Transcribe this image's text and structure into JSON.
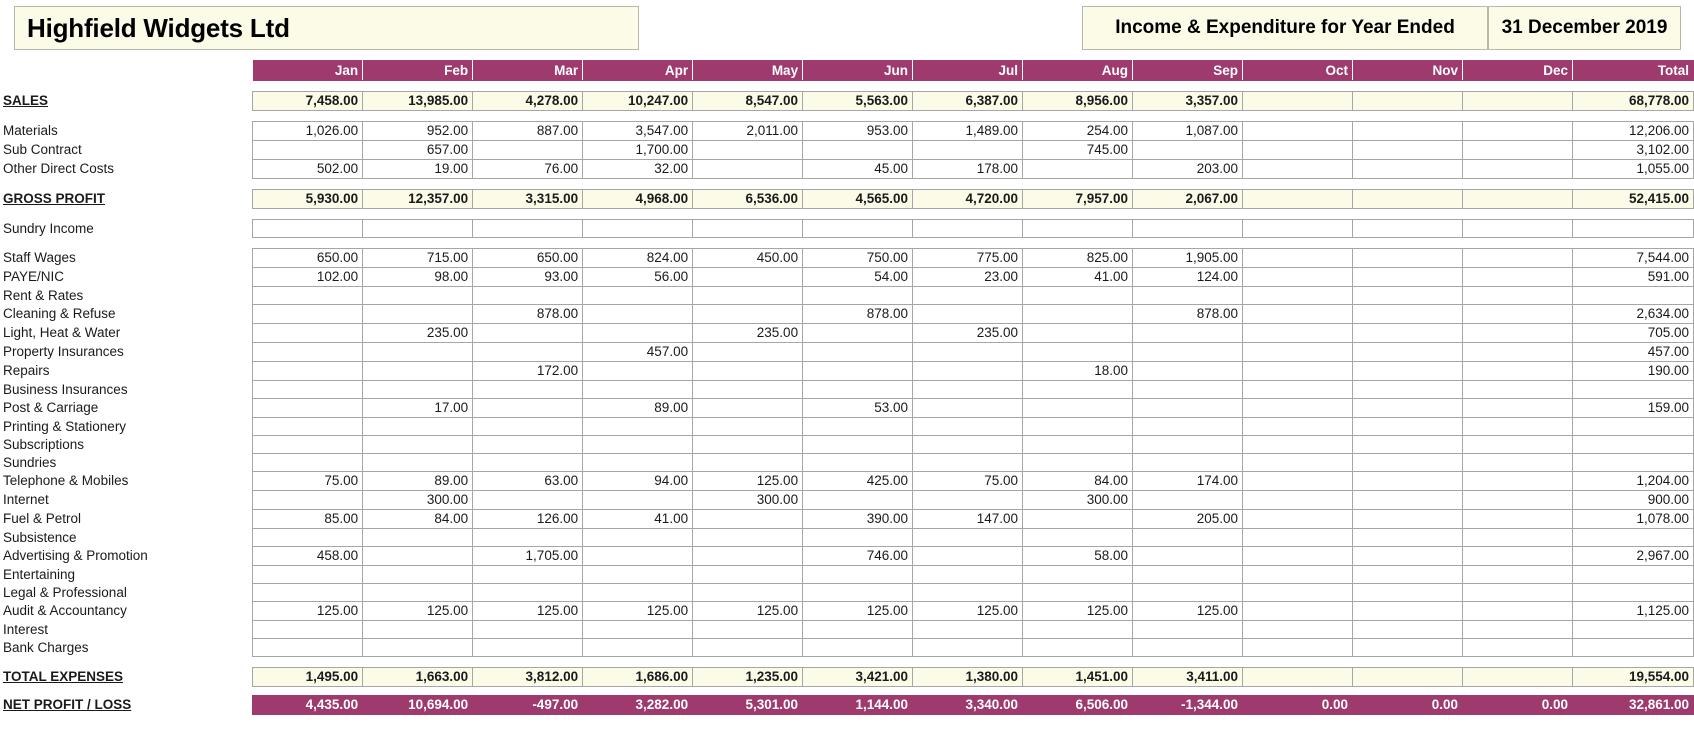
{
  "header": {
    "company": "Highfield Widgets Ltd",
    "doc_title": "Income & Expenditure for Year Ended",
    "doc_date": "31 December 2019"
  },
  "colors": {
    "accent": "#9e3a6d",
    "cream": "#fbfbe8",
    "grid": "#a6a6a6"
  },
  "columns": [
    "Jan",
    "Feb",
    "Mar",
    "Apr",
    "May",
    "Jun",
    "Jul",
    "Aug",
    "Sep",
    "Oct",
    "Nov",
    "Dec",
    "Total"
  ],
  "rows": [
    {
      "type": "gap"
    },
    {
      "type": "accent",
      "label": "SALES",
      "head": true,
      "values": [
        "7,458.00",
        "13,985.00",
        "4,278.00",
        "10,247.00",
        "8,547.00",
        "5,563.00",
        "6,387.00",
        "8,956.00",
        "3,357.00",
        "",
        "",
        "",
        "68,778.00"
      ]
    },
    {
      "type": "gap"
    },
    {
      "type": "data",
      "label": "Materials",
      "values": [
        "1,026.00",
        "952.00",
        "887.00",
        "3,547.00",
        "2,011.00",
        "953.00",
        "1,489.00",
        "254.00",
        "1,087.00",
        "",
        "",
        "",
        "12,206.00"
      ]
    },
    {
      "type": "data",
      "label": "Sub Contract",
      "values": [
        "",
        "657.00",
        "",
        "1,700.00",
        "",
        "",
        "",
        "745.00",
        "",
        "",
        "",
        "",
        "3,102.00"
      ]
    },
    {
      "type": "data",
      "label": "Other Direct Costs",
      "values": [
        "502.00",
        "19.00",
        "76.00",
        "32.00",
        "",
        "45.00",
        "178.00",
        "",
        "203.00",
        "",
        "",
        "",
        "1,055.00"
      ]
    },
    {
      "type": "gap"
    },
    {
      "type": "accent",
      "label": "GROSS PROFIT",
      "head": true,
      "values": [
        "5,930.00",
        "12,357.00",
        "3,315.00",
        "4,968.00",
        "6,536.00",
        "4,565.00",
        "4,720.00",
        "7,957.00",
        "2,067.00",
        "",
        "",
        "",
        "52,415.00"
      ]
    },
    {
      "type": "gap"
    },
    {
      "type": "data",
      "label": "Sundry Income",
      "values": [
        "",
        "",
        "",
        "",
        "",
        "",
        "",
        "",
        "",
        "",
        "",
        "",
        ""
      ]
    },
    {
      "type": "gap"
    },
    {
      "type": "data",
      "label": "Staff Wages",
      "values": [
        "650.00",
        "715.00",
        "650.00",
        "824.00",
        "450.00",
        "750.00",
        "775.00",
        "825.00",
        "1,905.00",
        "",
        "",
        "",
        "7,544.00"
      ]
    },
    {
      "type": "data",
      "label": "PAYE/NIC",
      "values": [
        "102.00",
        "98.00",
        "93.00",
        "56.00",
        "",
        "54.00",
        "23.00",
        "41.00",
        "124.00",
        "",
        "",
        "",
        "591.00"
      ]
    },
    {
      "type": "data",
      "label": "Rent & Rates",
      "values": [
        "",
        "",
        "",
        "",
        "",
        "",
        "",
        "",
        "",
        "",
        "",
        "",
        ""
      ]
    },
    {
      "type": "data",
      "label": "Cleaning & Refuse",
      "values": [
        "",
        "",
        "878.00",
        "",
        "",
        "878.00",
        "",
        "",
        "878.00",
        "",
        "",
        "",
        "2,634.00"
      ]
    },
    {
      "type": "data",
      "label": "Light, Heat & Water",
      "values": [
        "",
        "235.00",
        "",
        "",
        "235.00",
        "",
        "235.00",
        "",
        "",
        "",
        "",
        "",
        "705.00"
      ]
    },
    {
      "type": "data",
      "label": "Property Insurances",
      "values": [
        "",
        "",
        "",
        "457.00",
        "",
        "",
        "",
        "",
        "",
        "",
        "",
        "",
        "457.00"
      ]
    },
    {
      "type": "data",
      "label": "Repairs",
      "values": [
        "",
        "",
        "172.00",
        "",
        "",
        "",
        "",
        "18.00",
        "",
        "",
        "",
        "",
        "190.00"
      ]
    },
    {
      "type": "data",
      "label": "Business Insurances",
      "values": [
        "",
        "",
        "",
        "",
        "",
        "",
        "",
        "",
        "",
        "",
        "",
        "",
        ""
      ]
    },
    {
      "type": "data",
      "label": "Post & Carriage",
      "values": [
        "",
        "17.00",
        "",
        "89.00",
        "",
        "53.00",
        "",
        "",
        "",
        "",
        "",
        "",
        "159.00"
      ]
    },
    {
      "type": "data",
      "label": "Printing & Stationery",
      "values": [
        "",
        "",
        "",
        "",
        "",
        "",
        "",
        "",
        "",
        "",
        "",
        "",
        ""
      ]
    },
    {
      "type": "data",
      "label": "Subscriptions",
      "values": [
        "",
        "",
        "",
        "",
        "",
        "",
        "",
        "",
        "",
        "",
        "",
        "",
        ""
      ]
    },
    {
      "type": "data",
      "label": "Sundries",
      "values": [
        "",
        "",
        "",
        "",
        "",
        "",
        "",
        "",
        "",
        "",
        "",
        "",
        ""
      ]
    },
    {
      "type": "data",
      "label": "Telephone & Mobiles",
      "values": [
        "75.00",
        "89.00",
        "63.00",
        "94.00",
        "125.00",
        "425.00",
        "75.00",
        "84.00",
        "174.00",
        "",
        "",
        "",
        "1,204.00"
      ]
    },
    {
      "type": "data",
      "label": "Internet",
      "values": [
        "",
        "300.00",
        "",
        "",
        "300.00",
        "",
        "",
        "300.00",
        "",
        "",
        "",
        "",
        "900.00"
      ]
    },
    {
      "type": "data",
      "label": "Fuel & Petrol",
      "values": [
        "85.00",
        "84.00",
        "126.00",
        "41.00",
        "",
        "390.00",
        "147.00",
        "",
        "205.00",
        "",
        "",
        "",
        "1,078.00"
      ]
    },
    {
      "type": "data",
      "label": "Subsistence",
      "values": [
        "",
        "",
        "",
        "",
        "",
        "",
        "",
        "",
        "",
        "",
        "",
        "",
        ""
      ]
    },
    {
      "type": "data",
      "label": "Advertising & Promotion",
      "values": [
        "458.00",
        "",
        "1,705.00",
        "",
        "",
        "746.00",
        "",
        "58.00",
        "",
        "",
        "",
        "",
        "2,967.00"
      ]
    },
    {
      "type": "data",
      "label": "Entertaining",
      "values": [
        "",
        "",
        "",
        "",
        "",
        "",
        "",
        "",
        "",
        "",
        "",
        "",
        ""
      ]
    },
    {
      "type": "data",
      "label": "Legal & Professional",
      "values": [
        "",
        "",
        "",
        "",
        "",
        "",
        "",
        "",
        "",
        "",
        "",
        "",
        ""
      ]
    },
    {
      "type": "data",
      "label": "Audit & Accountancy",
      "values": [
        "125.00",
        "125.00",
        "125.00",
        "125.00",
        "125.00",
        "125.00",
        "125.00",
        "125.00",
        "125.00",
        "",
        "",
        "",
        "1,125.00"
      ]
    },
    {
      "type": "data",
      "label": "Interest",
      "values": [
        "",
        "",
        "",
        "",
        "",
        "",
        "",
        "",
        "",
        "",
        "",
        "",
        ""
      ]
    },
    {
      "type": "data",
      "label": "Bank Charges",
      "values": [
        "",
        "",
        "",
        "",
        "",
        "",
        "",
        "",
        "",
        "",
        "",
        "",
        ""
      ]
    },
    {
      "type": "gap"
    },
    {
      "type": "accent",
      "label": "TOTAL EXPENSES",
      "head": true,
      "values": [
        "1,495.00",
        "1,663.00",
        "3,812.00",
        "1,686.00",
        "1,235.00",
        "3,421.00",
        "1,380.00",
        "1,451.00",
        "3,411.00",
        "",
        "",
        "",
        "19,554.00"
      ]
    },
    {
      "type": "gap-sm"
    },
    {
      "type": "net",
      "label": "NET PROFIT / LOSS",
      "head": true,
      "values": [
        "4,435.00",
        "10,694.00",
        "-497.00",
        "3,282.00",
        "5,301.00",
        "1,144.00",
        "3,340.00",
        "6,506.00",
        "-1,344.00",
        "0.00",
        "0.00",
        "0.00",
        "32,861.00"
      ]
    }
  ]
}
